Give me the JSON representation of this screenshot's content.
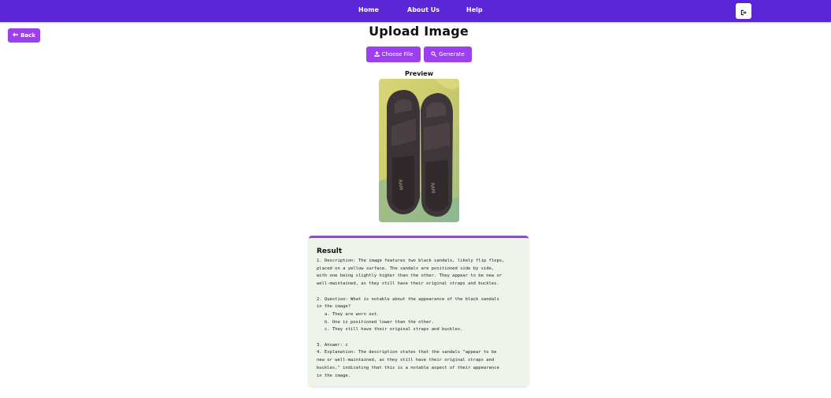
{
  "nav": {
    "links": [
      "Home",
      "About Us",
      "Help"
    ],
    "logout_icon": "logout-icon"
  },
  "back": {
    "label": "Back",
    "icon": "arrow-left-icon"
  },
  "title": "Upload Image",
  "actions": {
    "choose_label": "Choose File",
    "choose_icon": "upload-icon",
    "generate_label": "Generate",
    "generate_icon": "search-icon"
  },
  "preview": {
    "label": "Preview",
    "image_alt": "sandals-photo"
  },
  "result": {
    "title": "Result",
    "text": "1. Description: The image features two black sandals, likely flip flops,\nplaced on a yellow surface. The sandals are positioned side by side,\nwith one being slightly higher than the other. They appear to be new or\nwell-maintained, as they still have their original straps and buckles.\n\n2. Question: What is notable about the appearance of the black sandals\nin the image?\n   a. They are worn out.\n   b. One is positioned lower than the other.\n   c. They still have their original straps and buckles.\n\n3. Answer: c\n4. Explanation: The description states that the sandals \"appear to be\nnew or well-maintained, as they still have their original straps and\nbuckles,\" indicating that this is a notable aspect of their appearance\nin the image."
  },
  "colors": {
    "navbar": "#5b27d6",
    "accent": "#9b3ff0",
    "result_bg": "#eef4ea"
  }
}
